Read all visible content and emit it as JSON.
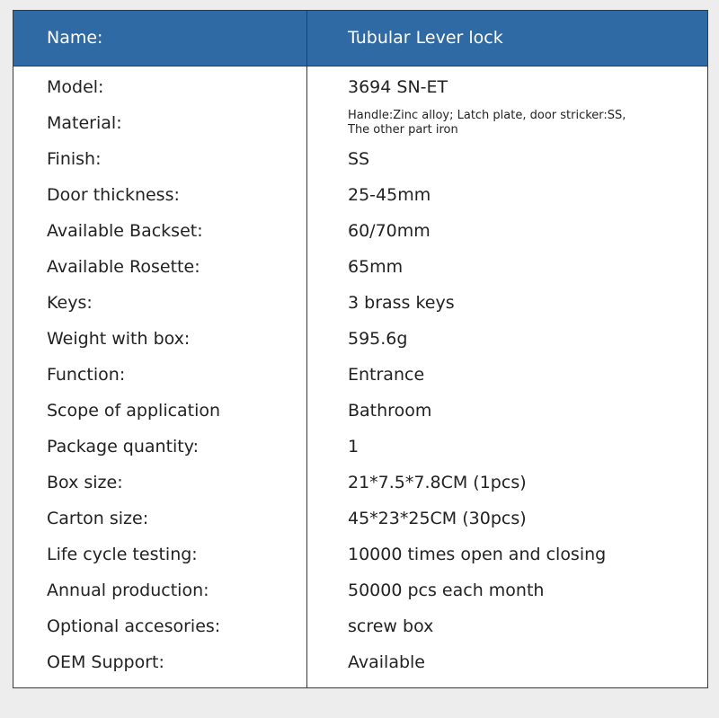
{
  "header": {
    "label": "Name:",
    "value": "Tubular Lever lock"
  },
  "rows": [
    {
      "label": "Model:",
      "value": "3694 SN-ET"
    },
    {
      "label": "Material:",
      "value_lines": [
        "Handle:Zinc alloy; Latch plate, door stricker:SS,",
        "The other part iron"
      ]
    },
    {
      "label": "Finish:",
      "value": "SS"
    },
    {
      "label": "Door thickness:",
      "value": "25-45mm"
    },
    {
      "label": "Available Backset:",
      "value": "60/70mm"
    },
    {
      "label": "Available Rosette:",
      "value": "65mm"
    },
    {
      "label": "Keys:",
      "value": "3 brass keys"
    },
    {
      "label": "Weight with box:",
      "value": "595.6g"
    },
    {
      "label": "Function:",
      "value": "Entrance"
    },
    {
      "label": "Scope of application",
      "value": "Bathroom"
    },
    {
      "label": "Package quantity:",
      "value": "1"
    },
    {
      "label": "Box size:",
      "value": "21*7.5*7.8CM (1pcs)"
    },
    {
      "label": "Carton size:",
      "value": "45*23*25CM (30pcs)"
    },
    {
      "label": "Life cycle testing:",
      "value": "10000 times open and closing"
    },
    {
      "label": "Annual production:",
      "value": "50000 pcs each month"
    },
    {
      "label": "Optional accesories:",
      "value": "screw box"
    },
    {
      "label": "OEM Support:",
      "value": "Available"
    }
  ],
  "colors": {
    "header_bg": "#2f6aa4",
    "border": "#3a3a3a",
    "page_bg": "#ededed"
  }
}
